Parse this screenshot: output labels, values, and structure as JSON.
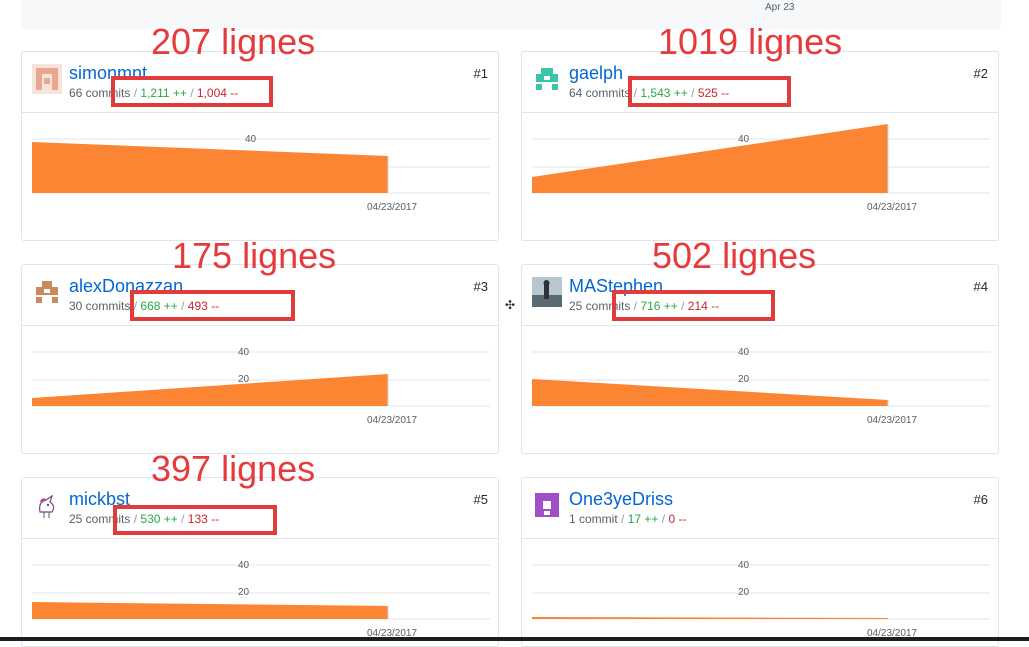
{
  "top_strip": {
    "date_label": "Apr 23"
  },
  "contributors": [
    {
      "name": "simonmnt",
      "rank": "#1",
      "commits": "66 commits",
      "additions": "1,211 ++",
      "deletions": "1,004 --",
      "annotation": "207 lignes",
      "date_label": "04/23/2017",
      "y_ticks": [
        "40"
      ]
    },
    {
      "name": "gaelph",
      "rank": "#2",
      "commits": "64 commits",
      "additions": "1,543 ++",
      "deletions": "525 --",
      "annotation": "1019 lignes",
      "date_label": "04/23/2017",
      "y_ticks": [
        "40"
      ]
    },
    {
      "name": "alexDonazzan",
      "rank": "#3",
      "commits": "30 commits",
      "additions": "668 ++",
      "deletions": "493 --",
      "annotation": "175 lignes",
      "date_label": "04/23/2017",
      "y_ticks": [
        "40",
        "20"
      ]
    },
    {
      "name": "MAStephen",
      "rank": "#4",
      "commits": "25 commits",
      "additions": "716 ++",
      "deletions": "214 --",
      "annotation": "502 lignes",
      "date_label": "04/23/2017",
      "y_ticks": [
        "40",
        "20"
      ]
    },
    {
      "name": "mickbst",
      "rank": "#5",
      "commits": "25 commits",
      "additions": "530 ++",
      "deletions": "133 --",
      "annotation": "397 lignes",
      "date_label": "04/23/2017",
      "y_ticks": [
        "40",
        "20"
      ]
    },
    {
      "name": "One3yeDriss",
      "rank": "#6",
      "commits": "1 commit",
      "additions": "17 ++",
      "deletions": "0 --",
      "annotation": "",
      "date_label": "04/23/2017",
      "y_ticks": [
        "40",
        "20"
      ]
    }
  ],
  "separator": "/",
  "colors": {
    "link": "#0366d6",
    "add": "#28a745",
    "del": "#cb2431",
    "area": "#fb8532",
    "annotation": "#e53b3b"
  },
  "icons": [
    "identicon-avatar",
    "photo-avatar",
    "unicorn-avatar",
    "move-cursor-icon"
  ]
}
